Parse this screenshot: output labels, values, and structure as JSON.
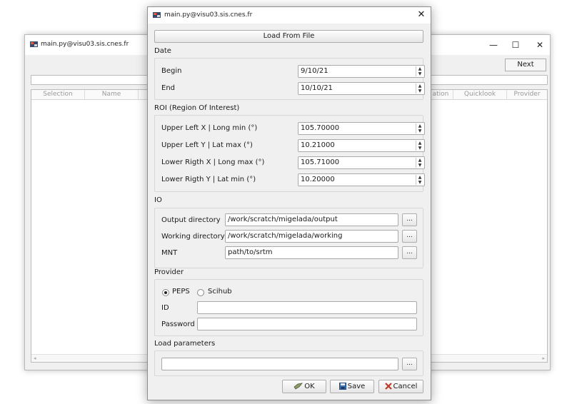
{
  "background_window": {
    "title": "main.py@visu03.sis.cnes.fr",
    "controls": {
      "minimize": "—",
      "maximize": "☐",
      "close": "✕"
    },
    "next_label": "Next",
    "table_headers": [
      "Selection",
      "Name",
      "ation",
      "Quicklook",
      "Provider"
    ]
  },
  "dialog": {
    "title": "main.py@visu03.sis.cnes.fr",
    "close_glyph": "✕",
    "load_from_file_label": "Load From File",
    "date": {
      "section_label": "Date",
      "begin_label": "Begin",
      "begin_value": "9/10/21",
      "end_label": "End",
      "end_value": "10/10/21"
    },
    "roi": {
      "section_label": "ROI (Region Of Interest)",
      "fields": [
        {
          "label": "Upper Left X  | Long min (°)",
          "value": "105.70000"
        },
        {
          "label": "Upper Left Y  | Lat max (°)",
          "value": "10.21000"
        },
        {
          "label": "Lower Rigth X | Long max (°)",
          "value": "105.71000"
        },
        {
          "label": "Lower Rigth Y | Lat min (°)",
          "value": "10.20000"
        }
      ]
    },
    "io": {
      "section_label": "IO",
      "output_label": "Output directory",
      "output_value": "/work/scratch/migelada/output",
      "working_label": "Working directory",
      "working_value": "/work/scratch/migelada/working",
      "mnt_label": "MNT",
      "mnt_value": "path/to/srtm",
      "browse_label": "..."
    },
    "provider": {
      "section_label": "Provider",
      "options": [
        "PEPS",
        "Scihub"
      ],
      "selected": "PEPS",
      "id_label": "ID",
      "id_value": "",
      "password_label": "Password",
      "password_value": ""
    },
    "load_parameters": {
      "section_label": "Load parameters",
      "value": "",
      "browse_label": "..."
    },
    "buttons": {
      "ok": "OK",
      "save": "Save",
      "cancel": "Cancel"
    }
  }
}
